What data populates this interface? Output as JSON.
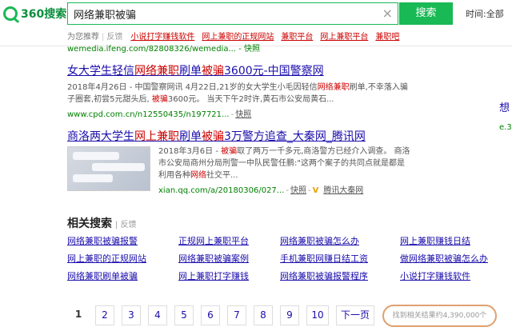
{
  "header": {
    "logo_text": "360搜索",
    "search_value": "网络兼职被骗",
    "clear_icon": "×",
    "search_button": "搜索",
    "time_label": "时间:",
    "time_value": "全部",
    "suggest_label": "为您推荐",
    "feedback": "反馈",
    "suggestions": [
      "小说打字赚钱软件",
      "网上兼职的正规网站",
      "兼职平台",
      "网上兼职平台",
      "兼职吧"
    ]
  },
  "top_snippet": "wemedia.ifeng.com/82808326/wemedia... - 快照",
  "results": [
    {
      "title_a": "女大学生轻信",
      "title_hl": "网络兼职",
      "title_b": "刷单",
      "title_hl2": "被骗",
      "title_c": "3600元-中国警察网",
      "desc_1": "2018年4月26日 - 中国警察网讯 4月22日,21岁的女大学生小毛因轻信",
      "desc_hl": "网络兼职",
      "desc_2": "刷单,不幸落入骗",
      "desc_3": "子圈套,初尝5元甜头后, ",
      "desc_hl2": "被骗",
      "desc_4": "3600元。 当天下午2时许,黄石市公安局黄石...",
      "url": "www.cpd.com.cn/n12550435/n197721...",
      "snapshot": "快照"
    },
    {
      "title_a": "商洛两大学生",
      "title_hl": "网上兼职",
      "title_b": "刷单",
      "title_hl2": "被骗",
      "title_c": "3万警方追查_大秦网_腾讯网",
      "desc_1": "2018年3月6日 - ",
      "desc_hl": "被骗",
      "desc_2": "取了两万一千多元,商洛警方已经介入调查。 商洛",
      "desc_3": "市公安局商州分局刑警一中队民警任鹏:\"这两个案子的共同点就是都是",
      "desc_4": "利用各种",
      "desc_hl2": "网络",
      "desc_5": "社交平...",
      "url": "xian.qq.com/a/20180306/027...",
      "snapshot": "快照",
      "source": "腾讯大秦网",
      "source_badge": "V"
    }
  ],
  "related": {
    "title": "相关搜索",
    "feedback": "反馈",
    "items": [
      "网络兼职被骗报警",
      "正规网上兼职平台",
      "网络兼职被骗怎么办",
      "网上兼职赚钱日结",
      "网上兼职的正规网站",
      "网络兼职被骗案例",
      "手机兼职网赚日结工资",
      "做网络兼职被骗怎么办",
      "网络兼职刷单被骗",
      "网上兼职打字赚钱",
      "网络兼职被骗报警程序",
      "小说打字赚钱软件"
    ]
  },
  "pagination": {
    "pages": [
      "1",
      "2",
      "3",
      "4",
      "5",
      "6",
      "7",
      "8",
      "9",
      "10"
    ],
    "next": "下一页",
    "current": "1",
    "results_count": "找到相关结果约4,390,000个"
  },
  "side": {
    "frag_1": "想",
    "frag_2": "e.3"
  },
  "colors": {
    "brand_green": "#19b955",
    "link_blue": "#1a0dab",
    "highlight_red": "#cc0000",
    "url_green": "#008000",
    "count_circle": "#e0a070"
  }
}
